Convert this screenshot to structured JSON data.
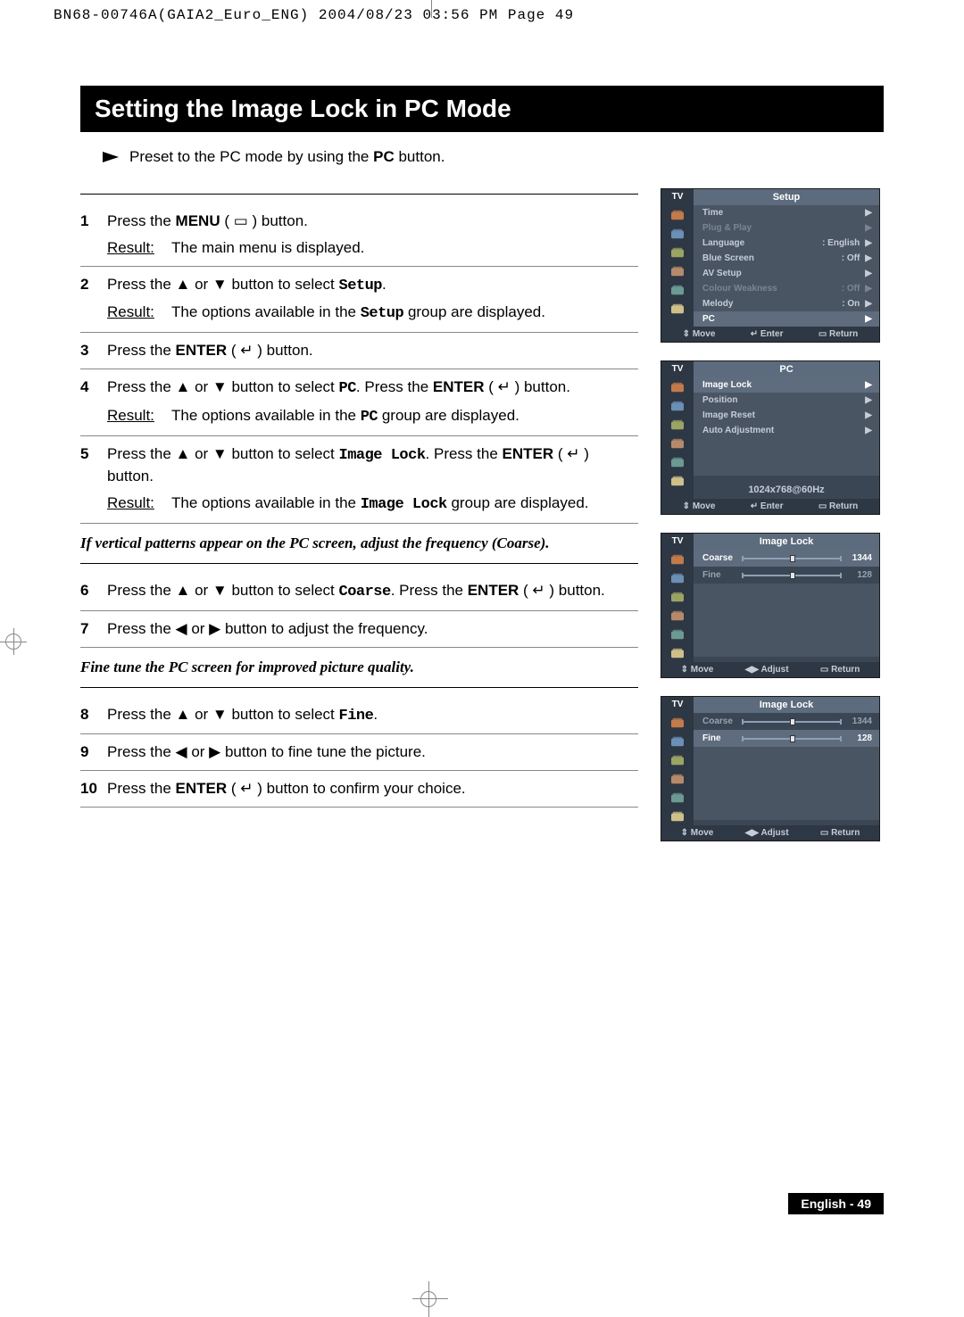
{
  "header": "BN68-00746A(GAIA2_Euro_ENG)  2004/08/23  03:56 PM  Page 49",
  "title": "Setting the Image Lock in PC Mode",
  "preset": "Preset to the PC mode by using the ",
  "preset_bold": "PC",
  "preset_end": " button.",
  "steps": [
    {
      "n": "1",
      "a": "Press the ",
      "b": "MENU",
      "c": " ( ▭ ) button.",
      "rlabel": "Result:",
      "r": "The main menu is displayed."
    },
    {
      "n": "2",
      "a": "Press the ▲ or ▼ button to select ",
      "mono": "Setup",
      "c": ".",
      "rlabel": "Result:",
      "r": "The options available in the ",
      "rmono": "Setup",
      "r2": " group are displayed."
    },
    {
      "n": "3",
      "a": "Press the ",
      "b": "ENTER",
      "c": " ( ↵ ) button."
    },
    {
      "n": "4",
      "a": "Press the ▲ or ▼ button to select ",
      "mono": "PC",
      "c": ". Press the ",
      "b": "ENTER",
      "c2": " ( ↵ ) button.",
      "rlabel": "Result:",
      "r": "The options available in the ",
      "rmono": "PC",
      "r2": " group are displayed."
    },
    {
      "n": "5",
      "a": "Press the ▲ or ▼ button to select ",
      "mono": "Image Lock",
      "c": ". Press the ",
      "b": "ENTER",
      "c2": " ( ↵ ) button.",
      "rlabel": "Result:",
      "r": "The options available in the ",
      "rmono": "Image Lock",
      "r2": " group are displayed."
    }
  ],
  "italic1": "If vertical patterns appear on the PC screen, adjust the frequency (Coarse).",
  "steps2": [
    {
      "n": "6",
      "a": "Press the ▲ or ▼ button to select ",
      "mono": "Coarse",
      "c": ". Press the ",
      "b": "ENTER",
      "c2": " ( ↵ ) button."
    },
    {
      "n": "7",
      "a": "Press the ◀ or ▶ button to adjust the frequency."
    }
  ],
  "italic2": "Fine tune the PC screen for improved picture quality.",
  "steps3": [
    {
      "n": "8",
      "a": "Press the ▲ or ▼ button to select ",
      "mono": "Fine",
      "c": "."
    },
    {
      "n": "9",
      "a": "Press the ◀ or ▶ button to fine tune the picture."
    },
    {
      "n": "10",
      "a": "Press the ",
      "b": "ENTER",
      "c": " ( ↵ ) button to confirm your choice."
    }
  ],
  "osd1": {
    "tv": "TV",
    "title": "Setup",
    "items": [
      {
        "label": "Time",
        "arr": "▶",
        "dim": false
      },
      {
        "label": "Plug & Play",
        "arr": "▶",
        "dim": true
      },
      {
        "label": "Language",
        "val": ": English",
        "arr": "▶",
        "dim": false
      },
      {
        "label": "Blue Screen",
        "val": ": Off",
        "arr": "▶",
        "dim": false
      },
      {
        "label": "AV Setup",
        "arr": "▶",
        "dim": false
      },
      {
        "label": "Colour Weakness",
        "val": ": Off",
        "arr": "▶",
        "dim": true
      },
      {
        "label": "Melody",
        "val": ": On",
        "arr": "▶",
        "dim": false
      },
      {
        "label": "PC",
        "arr": "▶",
        "sel": true
      }
    ],
    "foot": [
      "⇕ Move",
      "↵ Enter",
      "▭ Return"
    ]
  },
  "osd2": {
    "tv": "TV",
    "title": "PC",
    "items": [
      {
        "label": "Image Lock",
        "arr": "▶",
        "sel": true
      },
      {
        "label": "Position",
        "arr": "▶"
      },
      {
        "label": "Image Reset",
        "arr": "▶"
      },
      {
        "label": "Auto Adjustment",
        "arr": "▶"
      }
    ],
    "res": "1024x768@60Hz",
    "foot": [
      "⇕ Move",
      "↵ Enter",
      "▭ Return"
    ]
  },
  "osd3": {
    "tv": "TV",
    "title": "Image Lock",
    "sliders": [
      {
        "label": "Coarse",
        "val": "1344",
        "pos": 48,
        "sel": true
      },
      {
        "label": "Fine",
        "val": "128",
        "pos": 48
      }
    ],
    "foot": [
      "⇕ Move",
      "◀▶ Adjust",
      "▭ Return"
    ]
  },
  "osd4": {
    "tv": "TV",
    "title": "Image Lock",
    "sliders": [
      {
        "label": "Coarse",
        "val": "1344",
        "pos": 48
      },
      {
        "label": "Fine",
        "val": "128",
        "pos": 48,
        "sel": true
      }
    ],
    "foot": [
      "⇕ Move",
      "◀▶ Adjust",
      "▭ Return"
    ]
  },
  "footer": "English - 49"
}
